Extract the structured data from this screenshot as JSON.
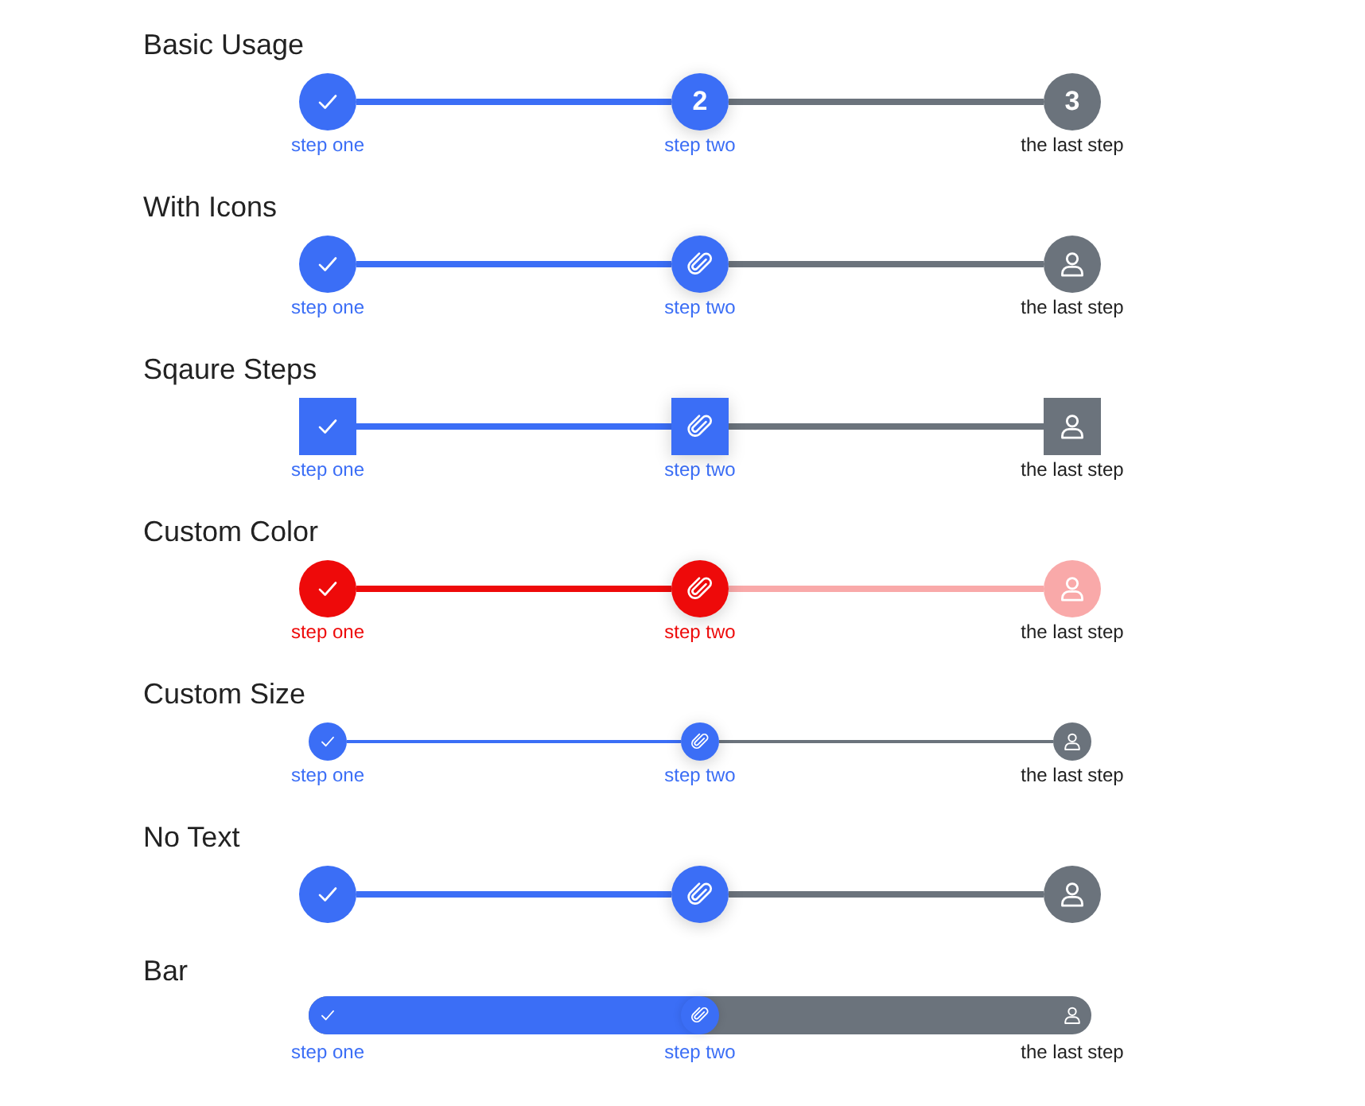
{
  "sections": [
    {
      "title": "Basic Usage",
      "kind": "circle",
      "color": "#3b6ef6",
      "steps": [
        {
          "label": "step one",
          "done": true,
          "current": false
        },
        {
          "label": "step two",
          "done": false,
          "current": true,
          "number": "2"
        },
        {
          "label": "the last step",
          "done": false,
          "current": false,
          "number": "3"
        }
      ]
    },
    {
      "title": "With Icons",
      "kind": "circle",
      "color": "#3b6ef6",
      "steps": [
        {
          "label": "step one",
          "done": true,
          "current": false
        },
        {
          "label": "step two",
          "done": false,
          "current": true
        },
        {
          "label": "the last step",
          "done": false,
          "current": false
        }
      ]
    },
    {
      "title": "Sqaure Steps",
      "kind": "square",
      "color": "#3b6ef6",
      "steps": [
        {
          "label": "step one",
          "done": true,
          "current": false
        },
        {
          "label": "step two",
          "done": false,
          "current": true
        },
        {
          "label": "the last step",
          "done": false,
          "current": false
        }
      ]
    },
    {
      "title": "Custom Color",
      "kind": "custom",
      "color": "#ee0a0a",
      "steps": [
        {
          "label": "step one",
          "done": true,
          "current": false
        },
        {
          "label": "step two",
          "done": false,
          "current": true
        },
        {
          "label": "the last step",
          "done": false,
          "current": false
        }
      ]
    },
    {
      "title": "Custom Size",
      "kind": "small",
      "color": "#3b6ef6",
      "steps": [
        {
          "label": "step one",
          "done": true,
          "current": false
        },
        {
          "label": "step two",
          "done": false,
          "current": true
        },
        {
          "label": "the last step",
          "done": false,
          "current": false
        }
      ]
    },
    {
      "title": "No Text",
      "kind": "no_text",
      "color": "#3b6ef6",
      "steps": [
        {
          "done": true,
          "current": false
        },
        {
          "done": false,
          "current": true
        },
        {
          "done": false,
          "current": false
        }
      ]
    },
    {
      "title": "Bar",
      "kind": "bar",
      "color": "#3b6ef6",
      "steps": [
        {
          "label": "step one",
          "done": true,
          "current": false
        },
        {
          "label": "step two",
          "done": false,
          "current": true
        },
        {
          "label": "the last step",
          "done": false,
          "current": false
        }
      ]
    }
  ]
}
